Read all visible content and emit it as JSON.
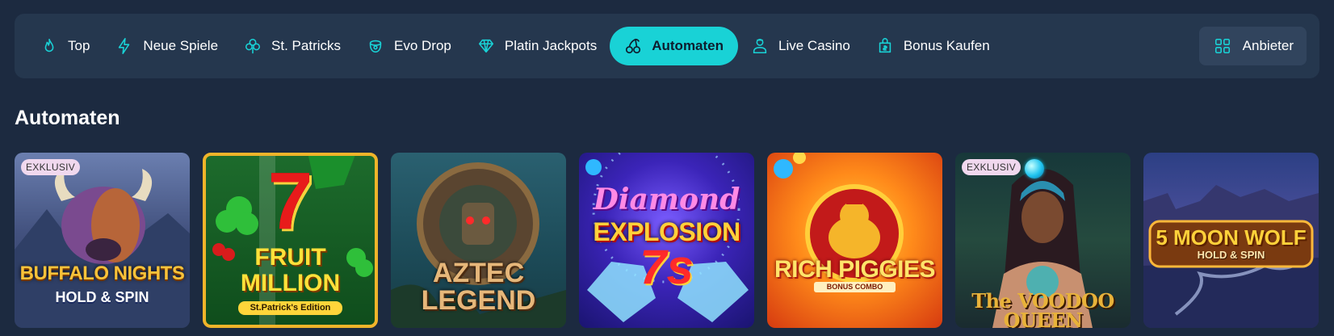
{
  "nav": {
    "items": [
      {
        "label": "Top",
        "icon": "flame-icon"
      },
      {
        "label": "Neue Spiele",
        "icon": "lightning-icon"
      },
      {
        "label": "St. Patricks",
        "icon": "clover-icon"
      },
      {
        "label": "Evo Drop",
        "icon": "treasure-pot-icon"
      },
      {
        "label": "Platin Jackpots",
        "icon": "diamond-icon"
      },
      {
        "label": "Automaten",
        "icon": "cherries-icon",
        "active": true
      },
      {
        "label": "Live Casino",
        "icon": "dealer-icon"
      },
      {
        "label": "Bonus Kaufen",
        "icon": "bonus-bag-icon"
      }
    ],
    "provider_label": "Anbieter",
    "active_color": "#19d2d6",
    "accent_color": "#19d2d6"
  },
  "section": {
    "title": "Automaten"
  },
  "games": [
    {
      "logo_line1": "BUFFALO NIGHTS",
      "logo_line2": "HOLD & SPIN",
      "badge": "EXKLUSIV"
    },
    {
      "logo_line1": "7",
      "logo_line2": "FRUIT MILLION",
      "logo_line3": "St.Patrick's Edition"
    },
    {
      "logo_line1": "AZTEC",
      "logo_line2": "LEGEND"
    },
    {
      "logo_line1": "Diamond",
      "logo_line2": "EXPLOSION",
      "logo_line3": "7s"
    },
    {
      "logo_line1": "RICH PIGGIES",
      "logo_line2": "BONUS COMBO"
    },
    {
      "logo_line1": "The VOODOO QUEEN",
      "badge": "EXKLUSIV"
    },
    {
      "logo_line1": "5 MOON WOLF",
      "logo_line2": "HOLD & SPIN"
    }
  ]
}
